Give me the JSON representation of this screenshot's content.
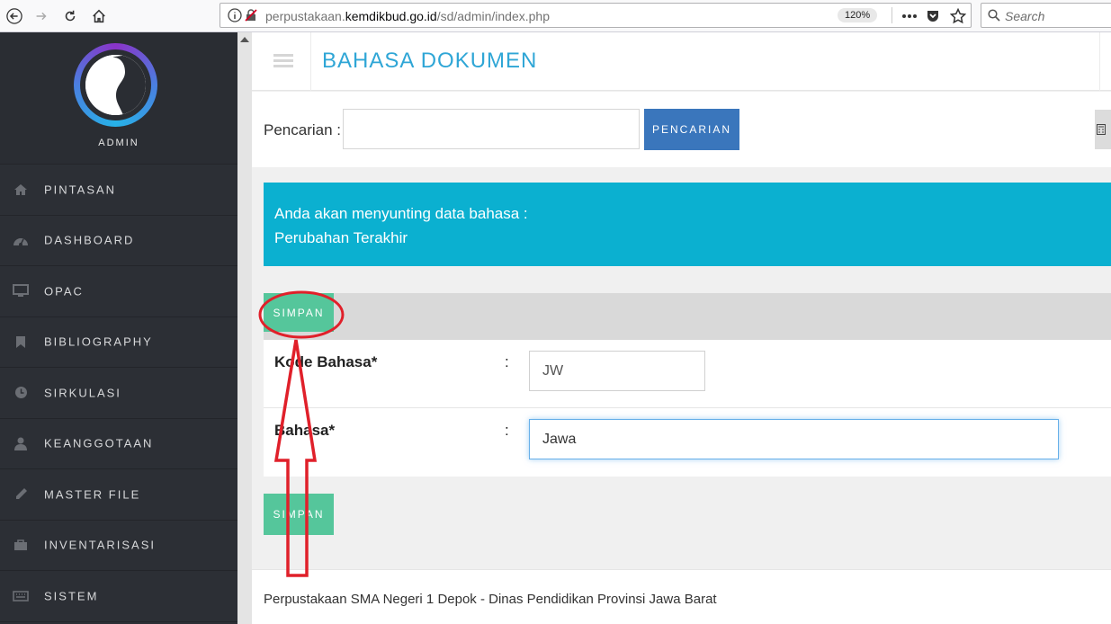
{
  "browser": {
    "url_prefix": "perpustakaan.",
    "url_domain": "kemdikbud.go.id",
    "url_path": "/sd/admin/index.php",
    "zoom": "120%",
    "search_placeholder": "Search"
  },
  "sidebar": {
    "profile_label": "ADMIN",
    "items": [
      {
        "label": "PINTASAN",
        "icon": "home-icon"
      },
      {
        "label": "DASHBOARD",
        "icon": "dashboard-icon"
      },
      {
        "label": "OPAC",
        "icon": "monitor-icon"
      },
      {
        "label": "BIBLIOGRAPHY",
        "icon": "bookmark-icon"
      },
      {
        "label": "SIRKULASI",
        "icon": "clock-icon"
      },
      {
        "label": "KEANGGOTAAN",
        "icon": "user-icon"
      },
      {
        "label": "MASTER FILE",
        "icon": "pencil-icon"
      },
      {
        "label": "INVENTARISASI",
        "icon": "briefcase-icon"
      },
      {
        "label": "SISTEM",
        "icon": "keyboard-icon"
      }
    ]
  },
  "header": {
    "title": "BAHASA DOKUMEN"
  },
  "search": {
    "label": "Pencarian :",
    "button": "PENCARIAN"
  },
  "info": {
    "line1": "Anda akan menyunting data bahasa :",
    "line2": "Perubahan Terakhir"
  },
  "form": {
    "save_top": "SIMPAN",
    "save_bottom": "SIMPAN",
    "colon": ":",
    "fields": [
      {
        "label": "Kode Bahasa*",
        "value": "JW"
      },
      {
        "label": "Bahasa*",
        "value": "Jawa"
      }
    ]
  },
  "footer": {
    "text": "Perpustakaan SMA Negeri 1 Depok - Dinas Pendidikan Provinsi Jawa Barat"
  },
  "colors": {
    "title": "#2fa6d6",
    "search_button": "#3a76bc",
    "info_box": "#0bb0d0",
    "save_button": "#55c69b",
    "annotation": "#e0202a",
    "sidebar": "#2c2f35"
  }
}
